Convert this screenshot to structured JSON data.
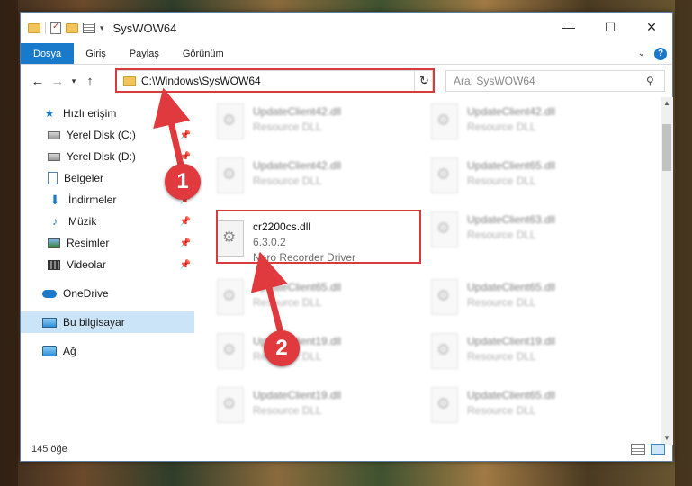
{
  "window": {
    "title": "SysWOW64"
  },
  "window_controls": {
    "minimize": "—",
    "maximize": "☐",
    "close": "✕"
  },
  "ribbon": {
    "tabs": [
      {
        "label": "Dosya",
        "active": true
      },
      {
        "label": "Giriş"
      },
      {
        "label": "Paylaş"
      },
      {
        "label": "Görünüm"
      }
    ],
    "help": "?"
  },
  "navigation": {
    "address": "C:\\Windows\\SysWOW64",
    "search_placeholder": "Ara: SysWOW64"
  },
  "sidebar": {
    "items": [
      {
        "label": "Hızlı erişim",
        "icon": "star-icon"
      },
      {
        "label": "Yerel Disk (C:)",
        "icon": "disk-icon",
        "pinned": true
      },
      {
        "label": "Yerel Disk (D:)",
        "icon": "disk-icon",
        "pinned": true
      },
      {
        "label": "Belgeler",
        "icon": "documents-icon",
        "pinned": true
      },
      {
        "label": "İndirmeler",
        "icon": "downloads-icon",
        "pinned": true
      },
      {
        "label": "Müzik",
        "icon": "music-icon",
        "pinned": true
      },
      {
        "label": "Resimler",
        "icon": "pictures-icon",
        "pinned": true
      },
      {
        "label": "Videolar",
        "icon": "videos-icon",
        "pinned": true
      },
      {
        "label": "OneDrive",
        "icon": "onedrive-icon"
      },
      {
        "label": "Bu bilgisayar",
        "icon": "this-pc-icon",
        "selected": true
      },
      {
        "label": "Ağ",
        "icon": "network-icon"
      }
    ]
  },
  "files": [
    {
      "name": "UpdateClient42.dll",
      "sub": "Resource DLL"
    },
    {
      "name": "UpdateClient42.dll",
      "sub": "Resource DLL"
    },
    {
      "name": "UpdateClient42.dll",
      "sub": "Resource DLL"
    },
    {
      "name": "UpdateClient65.dll",
      "sub": "Resource DLL"
    },
    {
      "name": "cr2200cs.dll",
      "version": "6.3.0.2",
      "description": "Nero Recorder Driver",
      "highlighted": true
    },
    {
      "name": "UpdateClient63.dll",
      "sub": "Resource DLL"
    },
    {
      "name": "UpdateClient65.dll",
      "sub": "Resource DLL"
    },
    {
      "name": "UpdateClient65.dll",
      "sub": "Resource DLL"
    },
    {
      "name": "UpdateClient19.dll",
      "sub": "Resource DLL"
    },
    {
      "name": "UpdateClient19.dll",
      "sub": "Resource DLL"
    },
    {
      "name": "UpdateClient19.dll",
      "sub": "Resource DLL"
    },
    {
      "name": "UpdateClient65.dll",
      "sub": "Resource DLL"
    }
  ],
  "status": {
    "item_count": "145 öğe"
  },
  "annotations": [
    {
      "number": "1",
      "color": "#e0393e"
    },
    {
      "number": "2",
      "color": "#e0393e"
    }
  ],
  "colors": {
    "accent": "#1979ca",
    "highlight": "#d73b3b",
    "selected": "#cce4f7"
  }
}
